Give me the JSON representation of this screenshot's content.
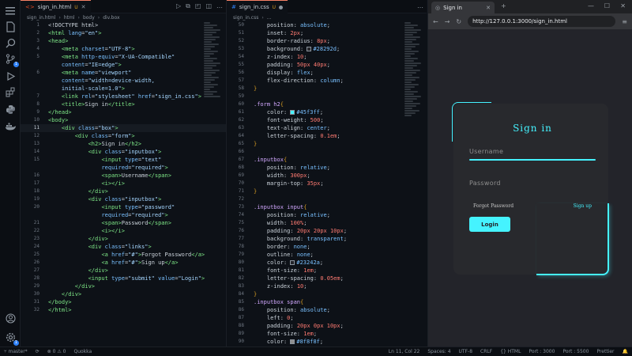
{
  "activity_bar": {
    "icons": [
      "menu-icon",
      "files-icon",
      "search-icon",
      "source-control-icon",
      "run-debug-icon",
      "extensions-icon",
      "python-icon",
      "docker-icon",
      "account-icon",
      "settings-icon"
    ],
    "badges": {
      "source_control": "1",
      "settings": "1"
    }
  },
  "editor1": {
    "tab_label": "sign_in.html",
    "tab_status": "U",
    "breadcrumbs": [
      "sign_in.html",
      "html",
      "body",
      "div.box"
    ],
    "lines": [
      {
        "n": "1",
        "html": "<span class='txtc'>&lt;!DOCTYPE html&gt;</span>"
      },
      {
        "n": "2",
        "html": "<span class='tag'>&lt;html</span> <span class='attr'>lang</span>=<span class='str'>\"en\"</span><span class='tag'>&gt;</span>"
      },
      {
        "n": "3",
        "html": "<span class='tag'>&lt;head&gt;</span>"
      },
      {
        "n": "4",
        "html": "    <span class='tag'>&lt;meta</span> <span class='attr'>charset</span>=<span class='str'>\"UTF-8\"</span><span class='tag'>&gt;</span>"
      },
      {
        "n": "5",
        "html": "    <span class='tag'>&lt;meta</span> <span class='attr'>http-equiv</span>=<span class='str'>\"X-UA-Compatible\"</span>"
      },
      {
        "n": "",
        "html": "    <span class='attr'>content</span>=<span class='str'>\"IE=edge\"</span><span class='tag'>&gt;</span>"
      },
      {
        "n": "6",
        "html": "    <span class='tag'>&lt;meta</span> <span class='attr'>name</span>=<span class='str'>\"viewport\"</span>"
      },
      {
        "n": "",
        "html": "    <span class='attr'>content</span>=<span class='str'>\"width=device-width,</span>"
      },
      {
        "n": "",
        "html": "    <span class='str'>initial-scale=1.0\"</span><span class='tag'>&gt;</span>"
      },
      {
        "n": "7",
        "html": "    <span class='tag'>&lt;link</span> <span class='attr'>rel</span>=<span class='str'>\"stylesheet\"</span> <span class='attr'>href</span>=<span class='str'>\"sign_in.css\"</span><span class='tag'>&gt;</span>"
      },
      {
        "n": "8",
        "html": "    <span class='tag'>&lt;title&gt;</span><span class='txtc'>Sign in</span><span class='tag'>&lt;/title&gt;</span>"
      },
      {
        "n": "9",
        "html": "<span class='tag'>&lt;/head&gt;</span>"
      },
      {
        "n": "10",
        "html": "<span class='tag'>&lt;body&gt;</span>"
      },
      {
        "n": "11",
        "html": "    <span class='tag'>&lt;div</span> <span class='attr'>class</span>=<span class='str'>\"box\"</span><span class='tag'>&gt;</span>",
        "current": true
      },
      {
        "n": "12",
        "html": "        <span class='tag'>&lt;div</span> <span class='attr'>class</span>=<span class='str'>\"form\"</span><span class='tag'>&gt;</span>"
      },
      {
        "n": "13",
        "html": "            <span class='tag'>&lt;h2&gt;</span><span class='txtc'>Sign in</span><span class='tag'>&lt;/h2&gt;</span>"
      },
      {
        "n": "14",
        "html": "            <span class='tag'>&lt;div</span> <span class='attr'>class</span>=<span class='str'>\"inputbox\"</span><span class='tag'>&gt;</span>"
      },
      {
        "n": "15",
        "html": "                <span class='tag'>&lt;input</span> <span class='attr'>type</span>=<span class='str'>\"text\"</span>"
      },
      {
        "n": "",
        "html": "                <span class='attr'>required</span>=<span class='str'>\"required\"</span><span class='tag'>&gt;</span>"
      },
      {
        "n": "16",
        "html": "                <span class='tag'>&lt;span&gt;</span><span class='txtc'>Username</span><span class='tag'>&lt;/span&gt;</span>"
      },
      {
        "n": "17",
        "html": "                <span class='tag'>&lt;i&gt;&lt;/i&gt;</span>"
      },
      {
        "n": "18",
        "html": "            <span class='tag'>&lt;/div&gt;</span>"
      },
      {
        "n": "19",
        "html": "            <span class='tag'>&lt;div</span> <span class='attr'>class</span>=<span class='str'>\"inputbox\"</span><span class='tag'>&gt;</span>"
      },
      {
        "n": "20",
        "html": "                <span class='tag'>&lt;input</span> <span class='attr'>type</span>=<span class='str'>\"password\"</span>"
      },
      {
        "n": "",
        "html": "                <span class='attr'>required</span>=<span class='str'>\"required\"</span><span class='tag'>&gt;</span>"
      },
      {
        "n": "21",
        "html": "                <span class='tag'>&lt;span&gt;</span><span class='txtc'>Password</span><span class='tag'>&lt;/span&gt;</span>"
      },
      {
        "n": "22",
        "html": "                <span class='tag'>&lt;i&gt;&lt;/i&gt;</span>"
      },
      {
        "n": "23",
        "html": "            <span class='tag'>&lt;/div&gt;</span>"
      },
      {
        "n": "24",
        "html": "            <span class='tag'>&lt;div</span> <span class='attr'>class</span>=<span class='str'>\"links\"</span><span class='tag'>&gt;</span>"
      },
      {
        "n": "25",
        "html": "                <span class='tag'>&lt;a</span> <span class='attr'>href</span>=<span class='str'>\"#\"</span><span class='tag'>&gt;</span><span class='txtc'>Forgot Password</span><span class='tag'>&lt;/a&gt;</span>"
      },
      {
        "n": "26",
        "html": "                <span class='tag'>&lt;a</span> <span class='attr'>href</span>=<span class='str'>\"#\"</span><span class='tag'>&gt;</span><span class='txtc'>Sign up</span><span class='tag'>&lt;/a&gt;</span>"
      },
      {
        "n": "27",
        "html": "            <span class='tag'>&lt;/div&gt;</span>"
      },
      {
        "n": "28",
        "html": "            <span class='tag'>&lt;input</span> <span class='attr'>type</span>=<span class='str'>\"submit\"</span> <span class='attr'>value</span>=<span class='str'>\"Login\"</span><span class='tag'>&gt;</span>"
      },
      {
        "n": "29",
        "html": "        <span class='tag'>&lt;/div&gt;</span>"
      },
      {
        "n": "30",
        "html": "    <span class='tag'>&lt;/div&gt;</span>"
      },
      {
        "n": "31",
        "html": "<span class='tag'>&lt;/body&gt;</span>"
      },
      {
        "n": "32",
        "html": "<span class='tag'>&lt;/html&gt;</span>"
      }
    ]
  },
  "editor2": {
    "tab_label": "sign_in.css",
    "tab_status": "U",
    "breadcrumbs": [
      "sign_in.css",
      "..."
    ],
    "lines": [
      {
        "n": "50",
        "html": "    <span class='prop'>position</span>: <span class='kw'>absolute</span>;"
      },
      {
        "n": "51",
        "html": "    <span class='prop'>inset</span>: <span class='num'>2px</span>;"
      },
      {
        "n": "52",
        "html": "    <span class='prop'>border-radius</span>: <span class='num'>8px</span>;"
      },
      {
        "n": "53",
        "html": "    <span class='prop'>background</span>: <span class='sw' style='background:#28292d'></span><span class='kw'>#28292d</span>;"
      },
      {
        "n": "54",
        "html": "    <span class='prop'>z-index</span>: <span class='num'>10</span>;"
      },
      {
        "n": "55",
        "html": "    <span class='prop'>padding</span>: <span class='num'>50px 40px</span>;"
      },
      {
        "n": "56",
        "html": "    <span class='prop'>display</span>: <span class='kw'>flex</span>;"
      },
      {
        "n": "57",
        "html": "    <span class='prop'>flex-direction</span>: <span class='kw'>column</span>;"
      },
      {
        "n": "58",
        "html": "<span class='brace'>}</span>"
      },
      {
        "n": "59",
        "html": ""
      },
      {
        "n": "60",
        "html": "<span class='sel'>.form h2</span><span class='brace'>{</span>"
      },
      {
        "n": "61",
        "html": "    <span class='prop'>color</span>: <span class='sw' style='background:#45f3ff'></span><span class='kw'>#45f3ff</span>;"
      },
      {
        "n": "62",
        "html": "    <span class='prop'>font-weight</span>: <span class='num'>500</span>;"
      },
      {
        "n": "63",
        "html": "    <span class='prop'>text-align</span>: <span class='kw'>center</span>;"
      },
      {
        "n": "64",
        "html": "    <span class='prop'>letter-spacing</span>: <span class='num'>0.1em</span>;"
      },
      {
        "n": "65",
        "html": "<span class='brace'>}</span>"
      },
      {
        "n": "66",
        "html": ""
      },
      {
        "n": "67",
        "html": "<span class='sel'>.inputbox</span><span class='brace'>{</span>"
      },
      {
        "n": "68",
        "html": "    <span class='prop'>position</span>: <span class='kw'>relative</span>;"
      },
      {
        "n": "69",
        "html": "    <span class='prop'>width</span>: <span class='num'>300px</span>;"
      },
      {
        "n": "70",
        "html": "    <span class='prop'>margin-top</span>: <span class='num'>35px</span>;"
      },
      {
        "n": "71",
        "html": "<span class='brace'>}</span>"
      },
      {
        "n": "72",
        "html": ""
      },
      {
        "n": "73",
        "html": "<span class='sel'>.inputbox input</span><span class='brace'>{</span>"
      },
      {
        "n": "74",
        "html": "    <span class='prop'>position</span>: <span class='kw'>relative</span>;"
      },
      {
        "n": "75",
        "html": "    <span class='prop'>width</span>: <span class='num'>100%</span>;"
      },
      {
        "n": "76",
        "html": "    <span class='prop'>padding</span>: <span class='num'>20px 20px 10px</span>;"
      },
      {
        "n": "77",
        "html": "    <span class='prop'>background</span>: <span class='kw'>transparent</span>;"
      },
      {
        "n": "78",
        "html": "    <span class='prop'>border</span>: <span class='kw'>none</span>;"
      },
      {
        "n": "79",
        "html": "    <span class='prop'>outline</span>: <span class='kw'>none</span>;"
      },
      {
        "n": "80",
        "html": "    <span class='prop'>color</span>: <span class='sw' style='background:#23242a'></span><span class='kw'>#23242a</span>;"
      },
      {
        "n": "81",
        "html": "    <span class='prop'>font-size</span>: <span class='num'>1em</span>;"
      },
      {
        "n": "82",
        "html": "    <span class='prop'>letter-spacing</span>: <span class='num'>0.05em</span>;"
      },
      {
        "n": "83",
        "html": "    <span class='prop'>z-index</span>: <span class='num'>10</span>;"
      },
      {
        "n": "84",
        "html": "<span class='brace'>}</span>"
      },
      {
        "n": "85",
        "html": "<span class='sel'>.inputbox span</span><span class='brace'>{</span>"
      },
      {
        "n": "86",
        "html": "    <span class='prop'>position</span>: <span class='kw'>absolute</span>;"
      },
      {
        "n": "87",
        "html": "    <span class='prop'>left</span>: <span class='num'>0</span>;"
      },
      {
        "n": "88",
        "html": "    <span class='prop'>padding</span>: <span class='num'>20px 0px 10px</span>;"
      },
      {
        "n": "89",
        "html": "    <span class='prop'>font-size</span>: <span class='num'>1em</span>;"
      },
      {
        "n": "90",
        "html": "    <span class='prop'>color</span>: <span class='sw' style='background:#8f8f8f'></span><span class='kw'>#8f8f8f</span>;"
      }
    ]
  },
  "browser": {
    "tab_title": "Sign in",
    "url": "http://127.0.0.1:3000/sign_in.html",
    "page": {
      "heading": "Sign in",
      "username_label": "Username",
      "password_label": "Password",
      "forgot_link": "Forgot Password",
      "signup_link": "Sign up",
      "submit_label": "Login",
      "accent": "#45f3ff"
    }
  },
  "status_bar": {
    "left": [
      "master*",
      "⊗ 0 ⚠ 0",
      "Quokka"
    ],
    "right": [
      "Ln 11, Col 22",
      "Spaces: 4",
      "UTF-8",
      "CRLF",
      "{} HTML",
      "Port : 3000",
      "Port : 5500",
      "Prettier"
    ]
  }
}
